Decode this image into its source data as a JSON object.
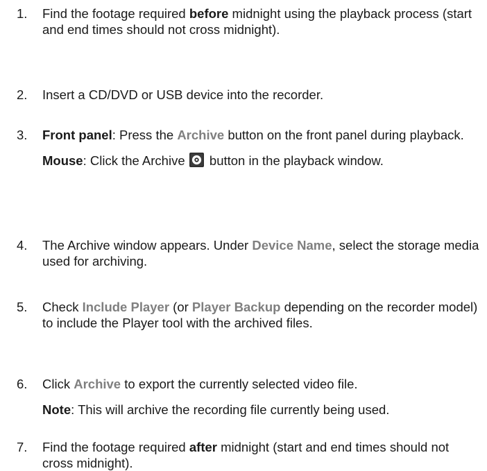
{
  "steps": [
    {
      "number": "1.",
      "paragraphs": [
        [
          {
            "t": "Find the footage required "
          },
          {
            "t": "before",
            "s": "b"
          },
          {
            "t": " midnight using the playback process (start and end times should not cross midnight)."
          }
        ]
      ]
    },
    {
      "number": "2.",
      "paragraphs": [
        [
          {
            "t": "Insert a CD/DVD or USB device into the recorder."
          }
        ]
      ]
    },
    {
      "number": "3.",
      "paragraphs": [
        [
          {
            "t": "Front panel",
            "s": "b"
          },
          {
            "t": ": Press the "
          },
          {
            "t": "Archive",
            "s": "ui"
          },
          {
            "t": " button on the front panel during playback."
          }
        ],
        [
          {
            "t": "Mouse",
            "s": "b"
          },
          {
            "t": ": Click the Archive "
          },
          {
            "icon": "archive-disc-icon"
          },
          {
            "t": " button in the playback window."
          }
        ]
      ]
    },
    {
      "number": "4.",
      "paragraphs": [
        [
          {
            "t": "The Archive window appears. Under "
          },
          {
            "t": "Device Name",
            "s": "ui"
          },
          {
            "t": ", select the storage media used for archiving."
          }
        ]
      ]
    },
    {
      "number": "5.",
      "paragraphs": [
        [
          {
            "t": "Check "
          },
          {
            "t": "Include Player",
            "s": "ui"
          },
          {
            "t": " (or "
          },
          {
            "t": "Player Backup",
            "s": "ui"
          },
          {
            "t": " depending on the recorder model) to include the Player tool with the archived files."
          }
        ]
      ]
    },
    {
      "number": "6.",
      "paragraphs": [
        [
          {
            "t": "Click "
          },
          {
            "t": "Archive",
            "s": "ui"
          },
          {
            "t": " to export the currently selected video file."
          }
        ],
        [
          {
            "t": "Note",
            "s": "b"
          },
          {
            "t": ": This will archive the recording file currently being used."
          }
        ]
      ]
    },
    {
      "number": "7.",
      "paragraphs": [
        [
          {
            "t": "Find the footage required "
          },
          {
            "t": "after",
            "s": "b"
          },
          {
            "t": " midnight (start and end times should not cross midnight)."
          }
        ]
      ]
    }
  ]
}
